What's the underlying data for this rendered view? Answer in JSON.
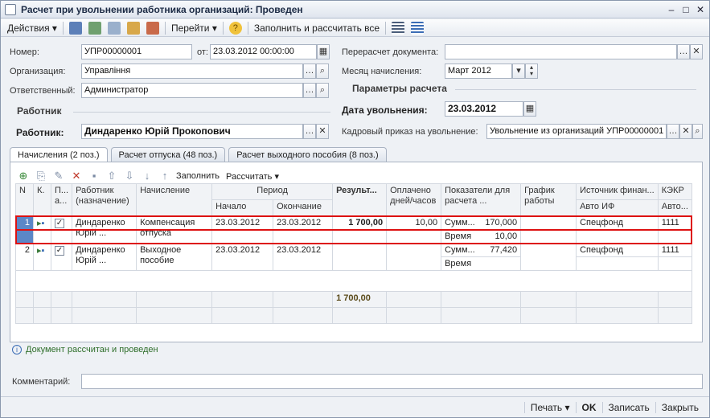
{
  "window": {
    "title": "Расчет при увольнении работника организаций: Проведен"
  },
  "toolbar": {
    "actions": "Действия",
    "goto": "Перейти",
    "fill_calc": "Заполнить и рассчитать все"
  },
  "form": {
    "number_label": "Номер:",
    "number": "УПР00000001",
    "from_label": "от:",
    "date": "23.03.2012 00:00:00",
    "org_label": "Организация:",
    "org": "Управління",
    "resp_label": "Ответственный:",
    "resp": "Администратор",
    "recalc_label": "Перерасчет документа:",
    "recalc": "",
    "month_label": "Месяц начисления:",
    "month": "Март 2012",
    "params_title": "Параметры расчета",
    "worker_section": "Работник",
    "worker_label": "Работник:",
    "worker": "Диндаренко Юрій Прокопович",
    "dismiss_label": "Дата увольнения:",
    "dismiss_date": "23.03.2012",
    "order_label": "Кадровый приказ на увольнение:",
    "order": "Увольнение из организаций УПР00000001"
  },
  "tabs": [
    "Начисления (2 поз.)",
    "Расчет отпуска (48 поз.)",
    "Расчет выходного пособия (8 поз.)"
  ],
  "grid_toolbar": {
    "fill": "Заполнить",
    "calc": "Рассчитать"
  },
  "grid": {
    "headers": {
      "n": "N",
      "k": "К.",
      "p": "П... а...",
      "worker": "Работник (назначение)",
      "accrual": "Начисление",
      "period": "Период",
      "start": "Начало",
      "end": "Окончание",
      "result": "Результ...",
      "paid": "Оплачено дней/часов",
      "indicators": "Показатели для расчета ...",
      "schedule": "График работы",
      "source": "Источник финан...",
      "auto_if": "Авто ИФ",
      "kekr": "КЭКР",
      "auto": "Авто..."
    },
    "rows": [
      {
        "n": "1",
        "worker": "Диндаренко Юрій ...",
        "accrual": "Компенсация отпуска",
        "start": "23.03.2012",
        "end": "23.03.2012",
        "result": "1 700,00",
        "paid": "10,00",
        "ind1": "Сумм...",
        "ind1v": "170,000",
        "ind2": "Время",
        "ind2v": "10,00",
        "source": "Спецфонд",
        "kekr": "1111"
      },
      {
        "n": "2",
        "worker": "Диндаренко Юрій ...",
        "accrual": "Выходное пособие",
        "start": "23.03.2012",
        "end": "23.03.2012",
        "result": "",
        "paid": "",
        "ind1": "Сумм...",
        "ind1v": "77,420",
        "ind2": "Время",
        "ind2v": "",
        "source": "Спецфонд",
        "kekr": "1111"
      }
    ],
    "total": "1 700,00"
  },
  "status": "Документ рассчитан и проведен",
  "comment_label": "Комментарий:",
  "bottom": {
    "print": "Печать",
    "ok": "OK",
    "save": "Записать",
    "close": "Закрыть"
  }
}
